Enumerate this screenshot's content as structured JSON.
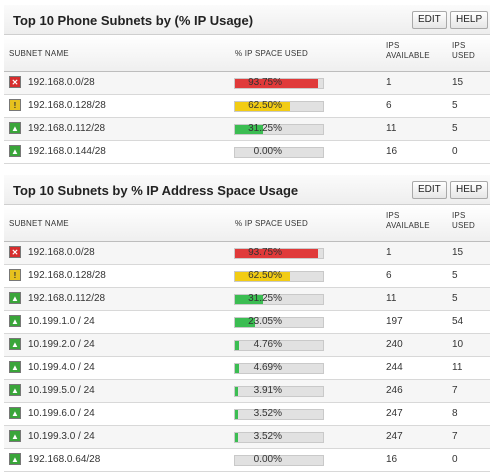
{
  "panel1": {
    "title": "Top 10 Phone Subnets by (% IP Usage)",
    "edit_label": "EDIT",
    "help_label": "HELP",
    "columns": {
      "subnet": "SUBNET NAME",
      "space": "% IP SPACE USED",
      "available": "IPS\nAVAILABLE",
      "used": "IPS\nUSED"
    },
    "rows": [
      {
        "subnet": "192.168.0.0/28",
        "pct": "93.75%",
        "fill": 0.9375,
        "status": "red",
        "available": "1",
        "used": "15"
      },
      {
        "subnet": "192.168.0.128/28",
        "pct": "62.50%",
        "fill": 0.625,
        "status": "yellow",
        "available": "6",
        "used": "5"
      },
      {
        "subnet": "192.168.0.112/28",
        "pct": "31.25%",
        "fill": 0.3125,
        "status": "green",
        "available": "11",
        "used": "5"
      },
      {
        "subnet": "192.168.0.144/28",
        "pct": "0.00%",
        "fill": 0.0,
        "status": "green",
        "available": "16",
        "used": "0"
      }
    ]
  },
  "panel2": {
    "title": "Top 10 Subnets by % IP Address Space Usage",
    "edit_label": "EDIT",
    "help_label": "HELP",
    "columns": {
      "subnet": "SUBNET NAME",
      "space": "% IP SPACE USED",
      "available": "IPS\nAVAILABLE",
      "used": "IPS\nUSED"
    },
    "rows": [
      {
        "subnet": "192.168.0.0/28",
        "pct": "93.75%",
        "fill": 0.9375,
        "status": "red",
        "available": "1",
        "used": "15"
      },
      {
        "subnet": "192.168.0.128/28",
        "pct": "62.50%",
        "fill": 0.625,
        "status": "yellow",
        "available": "6",
        "used": "5"
      },
      {
        "subnet": "192.168.0.112/28",
        "pct": "31.25%",
        "fill": 0.3125,
        "status": "green",
        "available": "11",
        "used": "5"
      },
      {
        "subnet": "10.199.1.0 / 24",
        "pct": "23.05%",
        "fill": 0.2305,
        "status": "green",
        "available": "197",
        "used": "54"
      },
      {
        "subnet": "10.199.2.0 / 24",
        "pct": "4.76%",
        "fill": 0.0476,
        "status": "green",
        "available": "240",
        "used": "10"
      },
      {
        "subnet": "10.199.4.0 / 24",
        "pct": "4.69%",
        "fill": 0.0469,
        "status": "green",
        "available": "244",
        "used": "11"
      },
      {
        "subnet": "10.199.5.0 / 24",
        "pct": "3.91%",
        "fill": 0.0391,
        "status": "green",
        "available": "246",
        "used": "7"
      },
      {
        "subnet": "10.199.6.0 / 24",
        "pct": "3.52%",
        "fill": 0.0352,
        "status": "green",
        "available": "247",
        "used": "8"
      },
      {
        "subnet": "10.199.3.0 / 24",
        "pct": "3.52%",
        "fill": 0.0352,
        "status": "green",
        "available": "247",
        "used": "7"
      },
      {
        "subnet": "192.168.0.64/28",
        "pct": "0.00%",
        "fill": 0.0,
        "status": "green",
        "available": "16",
        "used": "0"
      }
    ]
  },
  "status_colors": {
    "red": "#e03a3a",
    "yellow": "#f2cc14",
    "green": "#3bbd52"
  },
  "icons": {
    "red": "status-critical-icon",
    "yellow": "status-warning-icon",
    "green": "status-ok-icon"
  }
}
